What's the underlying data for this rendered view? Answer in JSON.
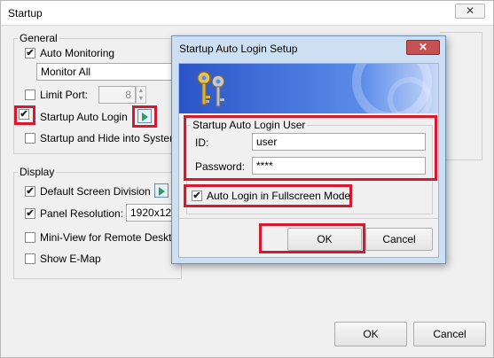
{
  "main": {
    "title": "Startup",
    "close_label": "✕",
    "general": {
      "legend": "General",
      "auto_monitoring": "Auto Monitoring",
      "auto_monitoring_checked": true,
      "monitor_value": "Monitor All",
      "limit_port": "Limit Port:",
      "limit_port_checked": false,
      "limit_port_value": "8",
      "startup_auto_login": "Startup Auto Login",
      "startup_auto_login_checked": true,
      "startup_hide": "Startup and Hide into System"
    },
    "display": {
      "legend": "Display",
      "default_screen_division": "Default Screen Division",
      "default_screen_division_checked": true,
      "panel_resolution": "Panel Resolution:",
      "panel_resolution_checked": true,
      "resolution_value": "1920x12",
      "mini_view": "Mini-View for Remote Desktop",
      "show_emap": "Show E-Map"
    },
    "ok": "OK",
    "cancel": "Cancel"
  },
  "dialog": {
    "title": "Startup Auto Login Setup",
    "close_label": "✕",
    "group_label": "Startup Auto Login User",
    "id_label": "ID:",
    "id_value": "user",
    "password_label": "Password:",
    "password_value": "****",
    "fullscreen_label": "Auto Login in Fullscreen Mode",
    "fullscreen_checked": true,
    "ok": "OK",
    "cancel": "Cancel"
  },
  "colors": {
    "highlight": "#d6192f",
    "dialog_frame": "#cde0f3",
    "close_red": "#c75050"
  }
}
